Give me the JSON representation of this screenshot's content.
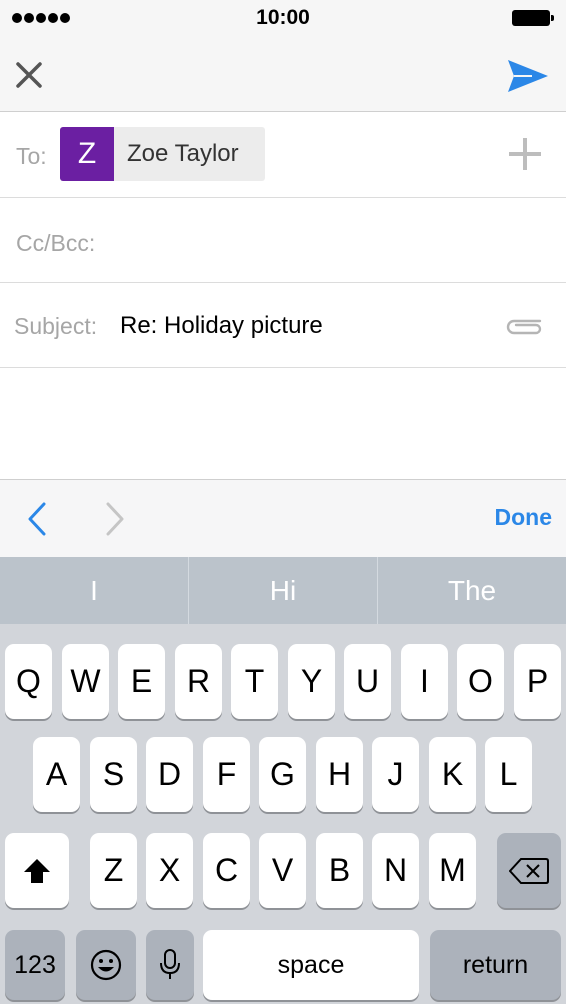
{
  "status_bar": {
    "time": "10:00"
  },
  "compose": {
    "to_label": "To:",
    "recipient": {
      "initial": "Z",
      "name": "Zoe Taylor",
      "avatar_color": "#6b1fa2"
    },
    "cc_label": "Cc/Bcc:",
    "subject_label": "Subject:",
    "subject_value": "Re: Holiday picture"
  },
  "accessory_bar": {
    "done_label": "Done",
    "accent_color": "#2b87e7"
  },
  "suggestions": [
    "I",
    "Hi",
    "The"
  ],
  "keyboard": {
    "row1": [
      "Q",
      "W",
      "E",
      "R",
      "T",
      "Y",
      "U",
      "I",
      "O",
      "P"
    ],
    "row2": [
      "A",
      "S",
      "D",
      "F",
      "G",
      "H",
      "J",
      "K",
      "L"
    ],
    "row3": [
      "Z",
      "X",
      "C",
      "V",
      "B",
      "N",
      "M"
    ],
    "numbers_label": "123",
    "space_label": "space",
    "return_label": "return",
    "icons": [
      "shift-icon",
      "delete-icon",
      "emoji-icon",
      "microphone-icon"
    ]
  }
}
